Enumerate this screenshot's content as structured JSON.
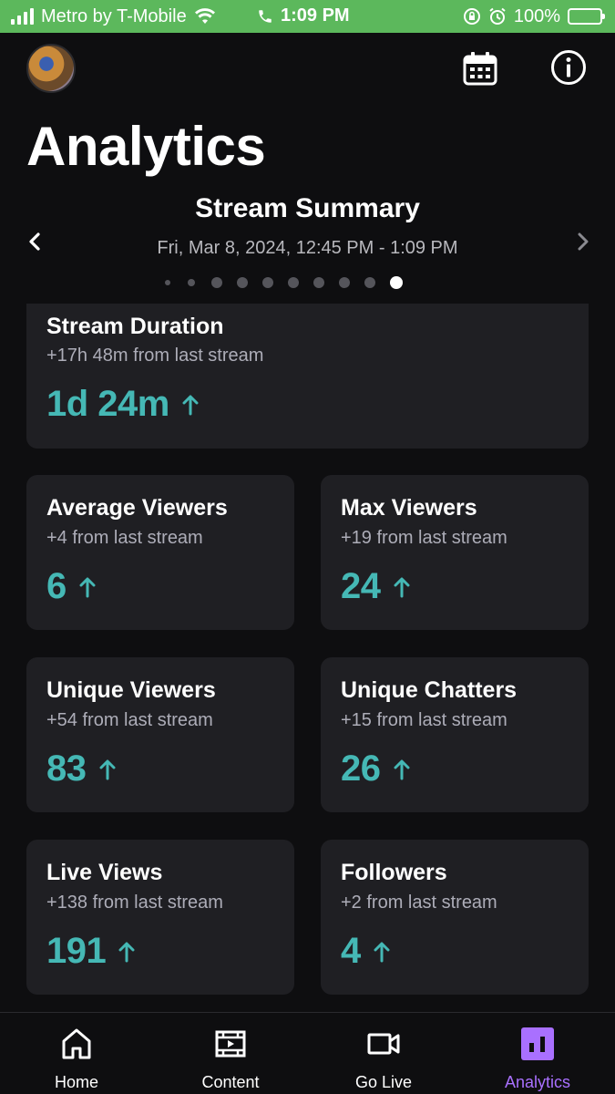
{
  "status_bar": {
    "carrier": "Metro by T-Mobile",
    "time": "1:09 PM",
    "battery": "100%"
  },
  "header": {
    "title": "Analytics",
    "calendar_icon": "calendar-icon",
    "info_icon": "info-icon"
  },
  "summary": {
    "title": "Stream Summary",
    "date_range": "Fri, Mar 8, 2024, 12:45 PM - 1:09 PM",
    "page_count": 10,
    "active_page": 10
  },
  "cards": {
    "duration": {
      "title": "Stream Duration",
      "sub": "+17h 48m from last stream",
      "value": "1d 24m"
    },
    "avg_viewers": {
      "title": "Average Viewers",
      "sub": "+4 from last stream",
      "value": "6"
    },
    "max_viewers": {
      "title": "Max Viewers",
      "sub": "+19 from last stream",
      "value": "24"
    },
    "unique_viewers": {
      "title": "Unique Viewers",
      "sub": "+54 from last stream",
      "value": "83"
    },
    "unique_chatters": {
      "title": "Unique Chatters",
      "sub": "+15 from last stream",
      "value": "26"
    },
    "live_views": {
      "title": "Live Views",
      "sub": "+138 from last stream",
      "value": "191"
    },
    "followers": {
      "title": "Followers",
      "sub": "+2 from last stream",
      "value": "4"
    }
  },
  "bottom_nav": {
    "home": "Home",
    "content": "Content",
    "go_live": "Go Live",
    "analytics": "Analytics"
  },
  "colors": {
    "accent_value": "#45b8b5",
    "active_nav": "#a970ff",
    "status_bar": "#5cb85c"
  }
}
